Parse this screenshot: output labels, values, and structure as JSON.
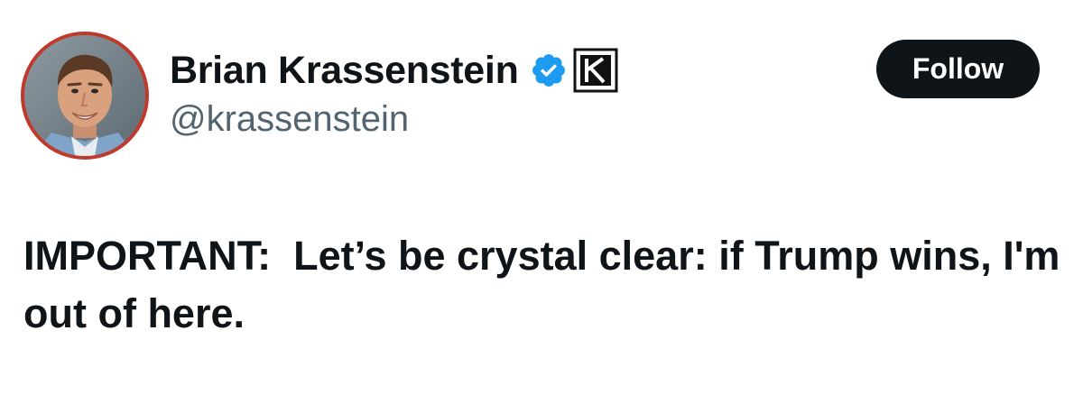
{
  "author": {
    "display_name": "Brian Krassenstein",
    "handle": "@krassenstein",
    "avatar_icon": "profile-photo",
    "verified_icon": "verified-badge-icon",
    "affiliate_icon": "k-affiliate-badge-icon",
    "avatar_ring_color": "#c0392b",
    "verified_color": "#1d9bf0"
  },
  "actions": {
    "follow_label": "Follow"
  },
  "tweet": {
    "text": "IMPORTANT:  Let’s be crystal clear: if Trump wins, I'm out of here."
  },
  "colors": {
    "text_primary": "#0f1419",
    "text_secondary": "#536471",
    "button_bg": "#0f1419"
  }
}
